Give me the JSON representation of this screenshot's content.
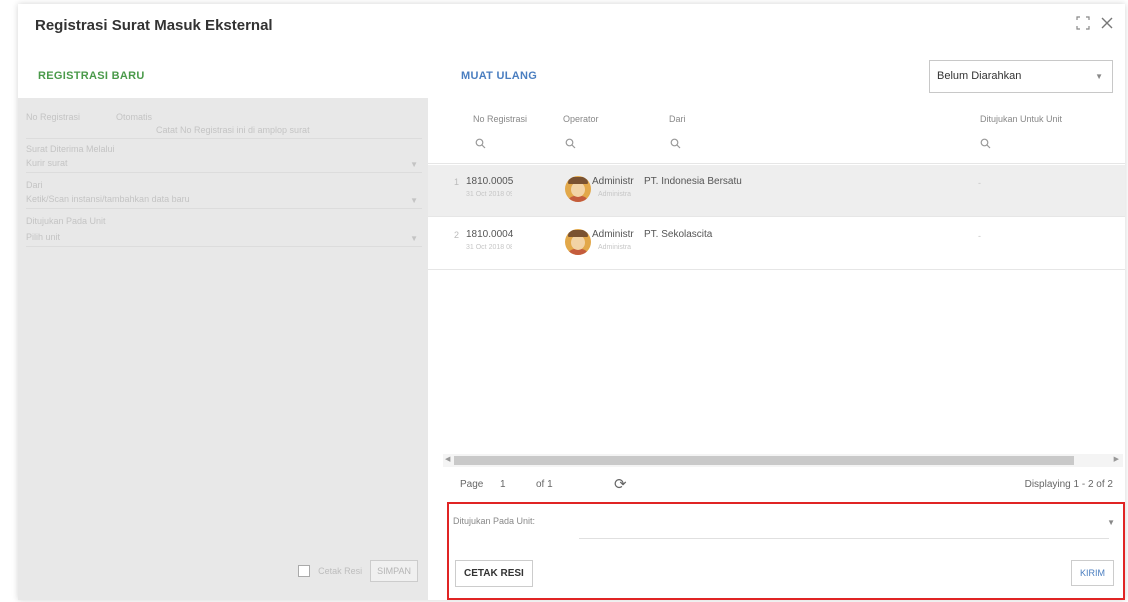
{
  "window": {
    "title": "Registrasi Surat Masuk Eksternal",
    "maximize_icon": "maximize-icon",
    "close_icon": "close-icon"
  },
  "left": {
    "registrasi_baru_label": "REGISTRASI BARU",
    "fields": [
      {
        "label": "No Registrasi",
        "value": "Otomatis",
        "hint": "Catat No Registrasi ini di amplop surat"
      },
      {
        "label": "Surat Diterima Melalui",
        "value": "Kurir surat"
      },
      {
        "label": "Dari",
        "value": "Ketik/Scan instansi/tambahkan data baru"
      },
      {
        "label": "Ditujukan Pada Unit",
        "value": "Pilih unit"
      }
    ],
    "cetak_resi_checkbox_label": "Cetak Resi",
    "simpan_label": "SIMPAN"
  },
  "right": {
    "muat_ulang_label": "MUAT ULANG",
    "filter_select": "Belum Diarahkan",
    "columns": [
      "No Registrasi",
      "Operator",
      "Dari",
      "Ditujukan Untuk Unit"
    ],
    "rows": [
      {
        "num": "1",
        "no_registrasi": "1810.0005",
        "date": "31 Oct 2018 09:17",
        "operator": "Administr",
        "operator_role": "Administra",
        "dari": "PT. Indonesia Bersatu",
        "unit": "-"
      },
      {
        "num": "2",
        "no_registrasi": "1810.0004",
        "date": "31 Oct 2018 08:53",
        "operator": "Administr",
        "operator_role": "Administra",
        "dari": "PT. Sekolascita",
        "unit": "-"
      }
    ],
    "pager": {
      "page_label": "Page",
      "page_value": "1",
      "of_label": "of 1",
      "displaying": "Displaying 1 - 2 of 2"
    },
    "ditujukan_label": "Ditujukan Pada Unit:",
    "cetak_resi_label": "CETAK RESI",
    "kirim_label": "KIRIM"
  },
  "colors": {
    "accent_green": "#4a9a4a",
    "accent_blue": "#4a7ec0",
    "highlight_red": "#e02424"
  }
}
